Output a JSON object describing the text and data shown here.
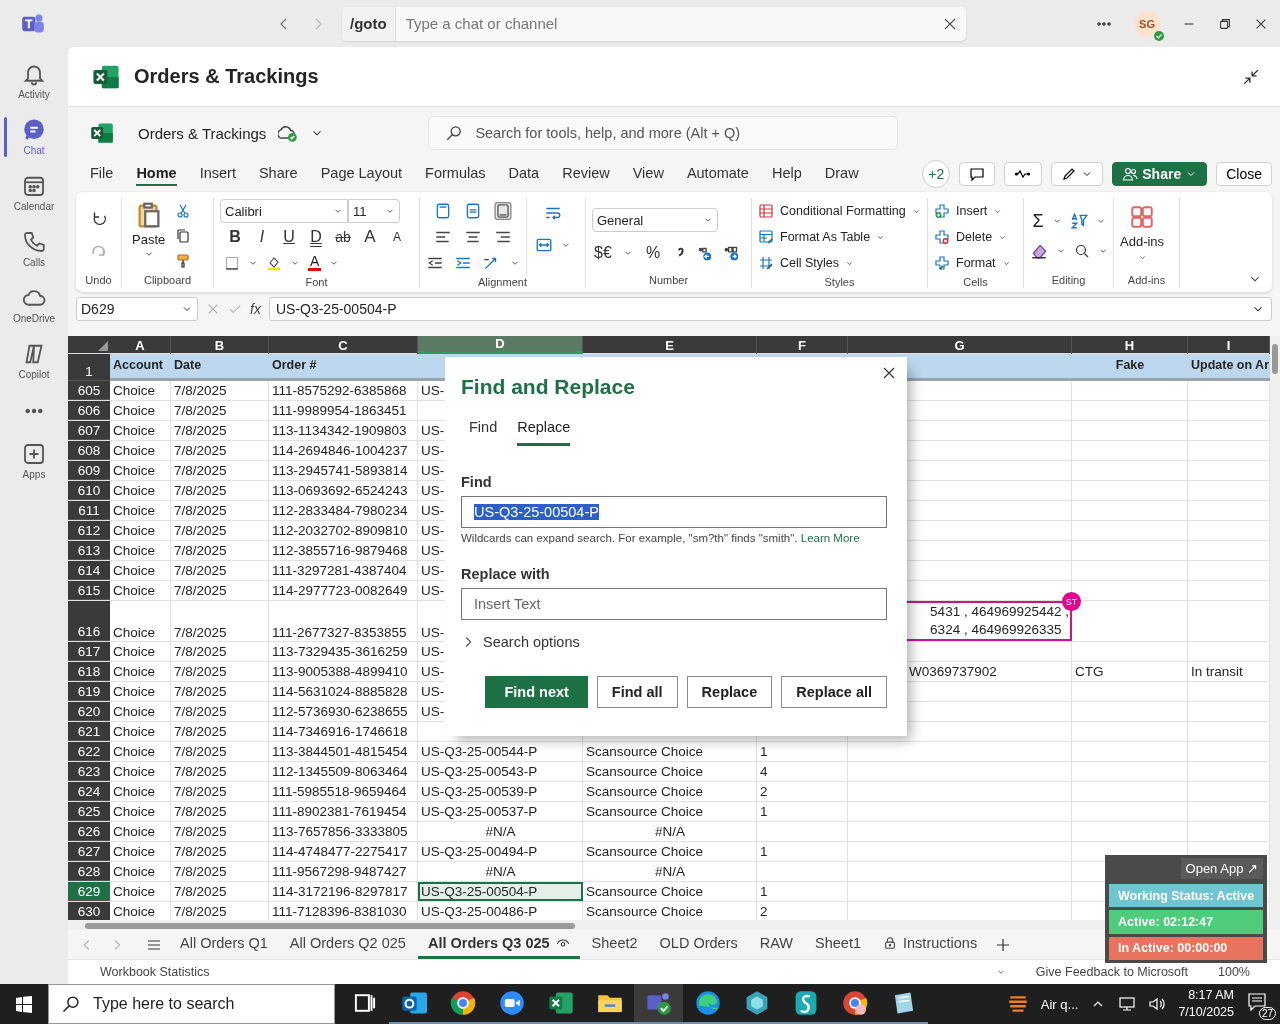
{
  "teams_bar": {
    "command": "/goto",
    "search": {
      "placeholder": "Type a chat or channel"
    },
    "avatar": "SG"
  },
  "rail": [
    {
      "label": "Activity",
      "selected": false
    },
    {
      "label": "Chat",
      "selected": true
    },
    {
      "label": "Calendar",
      "selected": false
    },
    {
      "label": "Calls",
      "selected": false
    },
    {
      "label": "OneDrive",
      "selected": false
    },
    {
      "label": "Copilot",
      "selected": false
    },
    {
      "label": "Apps",
      "selected": false
    }
  ],
  "app_header": {
    "title": "Orders & Trackings"
  },
  "workbook": {
    "name": "Orders & Trackings",
    "search": {
      "placeholder": "Search for tools, help, and more (Alt + Q)"
    }
  },
  "menu_tabs": [
    {
      "label": "File",
      "selected": false
    },
    {
      "label": "Home",
      "selected": true
    },
    {
      "label": "Insert",
      "selected": false
    },
    {
      "label": "Share",
      "selected": false
    },
    {
      "label": "Page Layout",
      "selected": false
    },
    {
      "label": "Formulas",
      "selected": false
    },
    {
      "label": "Data",
      "selected": false
    },
    {
      "label": "Review",
      "selected": false
    },
    {
      "label": "View",
      "selected": false
    },
    {
      "label": "Automate",
      "selected": false
    },
    {
      "label": "Help",
      "selected": false
    },
    {
      "label": "Draw",
      "selected": false
    }
  ],
  "collaborators": "+2",
  "share": "Share",
  "close": "Close",
  "ribbon": {
    "undo": {
      "label": "Undo"
    },
    "clipboard": {
      "paste": "Paste",
      "label": "Clipboard"
    },
    "font": {
      "name": "Calibri",
      "size": "11",
      "label": "Font",
      "buttons": [
        {
          "text": "B",
          "kind": "bold"
        },
        {
          "text": "I",
          "kind": "italic"
        },
        {
          "text": "U",
          "kind": "underline"
        },
        {
          "text": "D",
          "kind": "double"
        },
        {
          "text": "ab",
          "kind": "strike"
        },
        {
          "text": "A",
          "kind": "grow"
        },
        {
          "text": "A",
          "kind": "shrink"
        }
      ],
      "color_button": "A"
    },
    "alignment": {
      "label": "Alignment"
    },
    "number": {
      "format": "General",
      "currency": "$€",
      "percent": "%",
      "label": "Number"
    },
    "styles": {
      "items": [
        "Conditional Formatting",
        "Format As Table",
        "Cell Styles"
      ],
      "label": "Styles"
    },
    "cells": {
      "items": [
        "Insert",
        "Delete",
        "Format"
      ],
      "label": "Cells"
    },
    "editing": {
      "sum": "Σ",
      "label": "Editing"
    },
    "addins": {
      "button": "Add-ins",
      "label": "Add-ins"
    }
  },
  "formula_bar": {
    "name_box": "D629",
    "fx": "fx",
    "value": "US-Q3-25-00504-P"
  },
  "sheet": {
    "columns": [
      {
        "label": "A",
        "selected": false
      },
      {
        "label": "B",
        "selected": false
      },
      {
        "label": "C",
        "selected": false
      },
      {
        "label": "D",
        "selected": true
      },
      {
        "label": "E",
        "selected": false
      },
      {
        "label": "F",
        "selected": false
      },
      {
        "label": "G",
        "selected": false
      },
      {
        "label": "H",
        "selected": false
      },
      {
        "label": "I",
        "selected": false
      }
    ],
    "header_row": {
      "num": "1",
      "cells": [
        "Account",
        "Date",
        "Order #",
        null,
        null,
        null,
        null,
        {
          "text": "Fake",
          "kind": "center"
        },
        "Update on Ar"
      ]
    },
    "rows": [
      {
        "num": "605",
        "selected": false,
        "cells": [
          "Choice",
          "7/8/2025",
          "111-8575292-6385868",
          "US-"
        ]
      },
      {
        "num": "606",
        "selected": false,
        "cells": [
          "Choice",
          "7/8/2025",
          "111-9989954-1863451"
        ]
      },
      {
        "num": "607",
        "selected": false,
        "cells": [
          "Choice",
          "7/8/2025",
          "113-1134342-1909803",
          "US-"
        ]
      },
      {
        "num": "608",
        "selected": false,
        "cells": [
          "Choice",
          "7/8/2025",
          "114-2694846-1004237",
          "US-"
        ]
      },
      {
        "num": "609",
        "selected": false,
        "cells": [
          "Choice",
          "7/8/2025",
          "113-2945741-5893814",
          "US-"
        ]
      },
      {
        "num": "610",
        "selected": false,
        "cells": [
          "Choice",
          "7/8/2025",
          "113-0693692-6524243",
          "US-"
        ]
      },
      {
        "num": "611",
        "selected": false,
        "cells": [
          "Choice",
          "7/8/2025",
          "112-2833484-7980234",
          "US-"
        ]
      },
      {
        "num": "612",
        "selected": false,
        "cells": [
          "Choice",
          "7/8/2025",
          "112-2032702-8909810",
          "US-"
        ]
      },
      {
        "num": "613",
        "selected": false,
        "cells": [
          "Choice",
          "7/8/2025",
          "112-3855716-9879468",
          "US-"
        ]
      },
      {
        "num": "614",
        "selected": false,
        "cells": [
          "Choice",
          "7/8/2025",
          "111-3297281-4387404",
          "US-"
        ]
      },
      {
        "num": "615",
        "selected": false,
        "cells": [
          "Choice",
          "7/8/2025",
          "114-2977723-0082649",
          "US-"
        ]
      },
      {
        "num": "616",
        "selected": false,
        "cells": [
          "Choice",
          "7/8/2025",
          "111-2677327-8353855",
          "US-",
          null,
          null,
          {
            "lines": [
              "5431 , 464969925442 ,",
              "6324 , 464969926335"
            ],
            "kind": "covered",
            "badge": "ST"
          }
        ]
      },
      {
        "num": "617",
        "selected": false,
        "cells": [
          "Choice",
          "7/8/2025",
          "113-7329435-3616259",
          "US-"
        ]
      },
      {
        "num": "618",
        "selected": false,
        "cells": [
          "Choice",
          "7/8/2025",
          "113-9005388-4899410",
          "US-",
          null,
          null,
          {
            "text": "W0369737902",
            "kind": "covered"
          },
          "CTG",
          "In transit"
        ]
      },
      {
        "num": "619",
        "selected": false,
        "cells": [
          "Choice",
          "7/8/2025",
          "114-5631024-8885828",
          "US-"
        ]
      },
      {
        "num": "620",
        "selected": false,
        "cells": [
          "Choice",
          "7/8/2025",
          "112-5736930-6238655",
          "US-"
        ]
      },
      {
        "num": "621",
        "selected": false,
        "cells": [
          "Choice",
          "7/8/2025",
          "114-7346916-1746618"
        ]
      },
      {
        "num": "622",
        "selected": false,
        "cells": [
          "Choice",
          "7/8/2025",
          "113-3844501-4815454",
          "US-Q3-25-00544-P",
          "Scansource Choice",
          "1"
        ]
      },
      {
        "num": "623",
        "selected": false,
        "cells": [
          "Choice",
          "7/8/2025",
          "112-1345509-8063464",
          "US-Q3-25-00543-P",
          "Scansource Choice",
          "4"
        ]
      },
      {
        "num": "624",
        "selected": false,
        "cells": [
          "Choice",
          "7/8/2025",
          "111-5985518-9659464",
          "US-Q3-25-00539-P",
          "Scansource Choice",
          "2"
        ]
      },
      {
        "num": "625",
        "selected": false,
        "cells": [
          "Choice",
          "7/8/2025",
          "111-8902381-7619454",
          "US-Q3-25-00537-P",
          "Scansource Choice",
          "1"
        ]
      },
      {
        "num": "626",
        "selected": false,
        "cells": [
          "Choice",
          "7/8/2025",
          "113-7657856-3333805",
          {
            "text": "#N/A",
            "kind": "center"
          },
          {
            "text": "#N/A",
            "kind": "center"
          }
        ]
      },
      {
        "num": "627",
        "selected": false,
        "cells": [
          "Choice",
          "7/8/2025",
          "114-4748477-2275417",
          "US-Q3-25-00494-P",
          "Scansource Choice",
          "1"
        ]
      },
      {
        "num": "628",
        "selected": false,
        "cells": [
          "Choice",
          "7/8/2025",
          "111-9567298-9487427",
          {
            "text": "#N/A",
            "kind": "center"
          },
          {
            "text": "#N/A",
            "kind": "center"
          }
        ]
      },
      {
        "num": "629",
        "selected": true,
        "cells": [
          "Choice",
          "7/8/2025",
          "114-3172196-8297817",
          "US-Q3-25-00504-P",
          "Scansource Choice",
          "1"
        ]
      },
      {
        "num": "630",
        "selected": false,
        "cells": [
          "Choice",
          "7/8/2025",
          "111-7128396-8381030",
          "US-Q3-25-00486-P",
          "Scansource Choice",
          "2"
        ]
      }
    ]
  },
  "sheet_tabs": [
    {
      "label": "All Orders Q1",
      "selected": false,
      "kind": "plain"
    },
    {
      "label": "All Orders Q2 025",
      "selected": false,
      "kind": "plain"
    },
    {
      "label": "All Orders Q3 025",
      "selected": true,
      "kind": "viewed"
    },
    {
      "label": "Sheet2",
      "selected": false,
      "kind": "plain"
    },
    {
      "label": "OLD Orders",
      "selected": false,
      "kind": "plain"
    },
    {
      "label": "RAW",
      "selected": false,
      "kind": "plain"
    },
    {
      "label": "Sheet1",
      "selected": false,
      "kind": "plain"
    },
    {
      "label": "Instructions",
      "selected": false,
      "kind": "locked"
    }
  ],
  "status_bar": {
    "left": "Workbook Statistics",
    "feedback": "Give Feedback to Microsoft",
    "zoom": "100%"
  },
  "dialog": {
    "title": "Find and Replace",
    "tabs": [
      {
        "label": "Find",
        "selected": false
      },
      {
        "label": "Replace",
        "selected": true
      }
    ],
    "find": {
      "label": "Find",
      "value": "US-Q3-25-00504-P",
      "highlighted": true
    },
    "hint": "Wildcards can expand search. For example, \"sm?th\" finds \"smith\".",
    "hint_link": "Learn More",
    "replace": {
      "label": "Replace with",
      "placeholder": "Insert Text"
    },
    "search_options": {
      "label": "Search options",
      "expanded": false
    },
    "buttons": [
      {
        "label": "Find next",
        "kind": "primary"
      },
      {
        "label": "Find all",
        "kind": "secondary"
      },
      {
        "label": "Replace",
        "kind": "secondary"
      },
      {
        "label": "Replace all",
        "kind": "secondary"
      }
    ]
  },
  "tracker": {
    "open_app": "Open App ↗",
    "rows": [
      {
        "text": "Working Status: Active",
        "color": "#6fc5d0"
      },
      {
        "text": "Active: 02:12:47",
        "color": "#4fcb7c"
      },
      {
        "text": "In Active: 00:00:00",
        "color": "#e8735f"
      }
    ]
  },
  "taskbar": {
    "search": {
      "placeholder": "Type here to search"
    },
    "apps": [
      {
        "selected": false
      },
      {
        "selected": false
      },
      {
        "selected": false
      },
      {
        "selected": false
      },
      {
        "selected": false
      },
      {
        "selected": false
      },
      {
        "selected": true
      },
      {
        "selected": false
      },
      {
        "selected": false
      },
      {
        "selected": false
      },
      {
        "selected": false
      },
      {
        "selected": false
      }
    ],
    "weather": "Air q...",
    "time": "8:17 AM",
    "date": "7/10/2025",
    "notifications": "27"
  }
}
